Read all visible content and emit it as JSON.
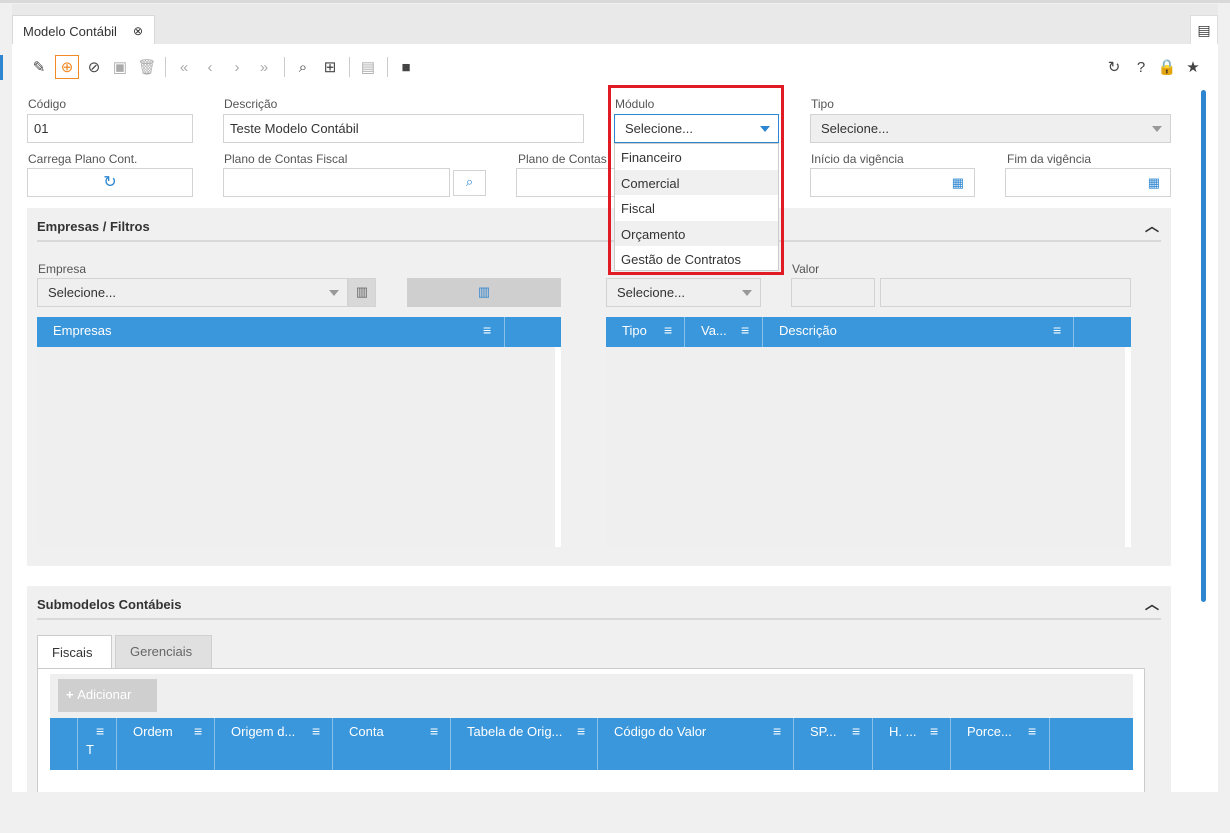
{
  "window": {
    "tab_title": "Modelo Contábil",
    "tab_close_icon": "close-circle-icon"
  },
  "toolbar": {
    "icons": [
      "broom-icon",
      "add-icon",
      "cancel-icon",
      "save-icon",
      "delete-icon",
      "first-icon",
      "prev-icon",
      "next-icon",
      "last-icon",
      "search-icon",
      "grid-icon",
      "copy-icon",
      "window-icon"
    ],
    "right_icons": [
      "refresh-icon",
      "help-icon",
      "lock-icon",
      "star-icon"
    ]
  },
  "form": {
    "codigo_label": "Código",
    "codigo_value": "01",
    "descricao_label": "Descrição",
    "descricao_value": "Teste Modelo Contábil",
    "modulo_label": "Módulo",
    "modulo_value": "Selecione...",
    "tipo_label": "Tipo",
    "tipo_value": "Selecione...",
    "carrega_label": "Carrega Plano Cont.",
    "plano_fiscal_label": "Plano de Contas Fiscal",
    "plano_contas_label": "Plano de Contas",
    "inicio_label": "Início da vigência",
    "fim_label": "Fim da vigência"
  },
  "modulo_options": [
    "Financeiro",
    "Comercial",
    "Fiscal",
    "Orçamento",
    "Gestão de Contratos"
  ],
  "empresas_panel": {
    "title": "Empresas / Filtros",
    "empresa_label": "Empresa",
    "empresa_value": "Selecione...",
    "filtro_value": "Selecione...",
    "valor_label": "Valor",
    "empresas_grid_header": "Empresas",
    "filtros_headers": [
      "Tipo",
      "Va...",
      "Descrição"
    ]
  },
  "submodelos_panel": {
    "title": "Submodelos Contábeis",
    "tabs": [
      "Fiscais",
      "Gerenciais"
    ],
    "add_label": "Adicionar",
    "headers": [
      "T",
      "Ordem",
      "Origem d...",
      "Conta",
      "Tabela de Orig...",
      "Código do Valor",
      "SP...",
      "H. ...",
      "Porce..."
    ]
  },
  "colors": {
    "accent": "#3a97db",
    "highlight": "#e01b24",
    "active": "#f08a24"
  }
}
